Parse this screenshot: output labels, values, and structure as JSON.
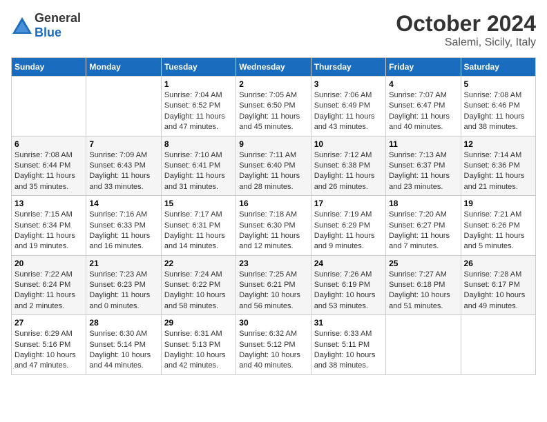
{
  "header": {
    "logo_general": "General",
    "logo_blue": "Blue",
    "month": "October 2024",
    "location": "Salemi, Sicily, Italy"
  },
  "weekdays": [
    "Sunday",
    "Monday",
    "Tuesday",
    "Wednesday",
    "Thursday",
    "Friday",
    "Saturday"
  ],
  "weeks": [
    [
      {
        "day": "",
        "info": ""
      },
      {
        "day": "",
        "info": ""
      },
      {
        "day": "1",
        "info": "Sunrise: 7:04 AM\nSunset: 6:52 PM\nDaylight: 11 hours and 47 minutes."
      },
      {
        "day": "2",
        "info": "Sunrise: 7:05 AM\nSunset: 6:50 PM\nDaylight: 11 hours and 45 minutes."
      },
      {
        "day": "3",
        "info": "Sunrise: 7:06 AM\nSunset: 6:49 PM\nDaylight: 11 hours and 43 minutes."
      },
      {
        "day": "4",
        "info": "Sunrise: 7:07 AM\nSunset: 6:47 PM\nDaylight: 11 hours and 40 minutes."
      },
      {
        "day": "5",
        "info": "Sunrise: 7:08 AM\nSunset: 6:46 PM\nDaylight: 11 hours and 38 minutes."
      }
    ],
    [
      {
        "day": "6",
        "info": "Sunrise: 7:08 AM\nSunset: 6:44 PM\nDaylight: 11 hours and 35 minutes."
      },
      {
        "day": "7",
        "info": "Sunrise: 7:09 AM\nSunset: 6:43 PM\nDaylight: 11 hours and 33 minutes."
      },
      {
        "day": "8",
        "info": "Sunrise: 7:10 AM\nSunset: 6:41 PM\nDaylight: 11 hours and 31 minutes."
      },
      {
        "day": "9",
        "info": "Sunrise: 7:11 AM\nSunset: 6:40 PM\nDaylight: 11 hours and 28 minutes."
      },
      {
        "day": "10",
        "info": "Sunrise: 7:12 AM\nSunset: 6:38 PM\nDaylight: 11 hours and 26 minutes."
      },
      {
        "day": "11",
        "info": "Sunrise: 7:13 AM\nSunset: 6:37 PM\nDaylight: 11 hours and 23 minutes."
      },
      {
        "day": "12",
        "info": "Sunrise: 7:14 AM\nSunset: 6:36 PM\nDaylight: 11 hours and 21 minutes."
      }
    ],
    [
      {
        "day": "13",
        "info": "Sunrise: 7:15 AM\nSunset: 6:34 PM\nDaylight: 11 hours and 19 minutes."
      },
      {
        "day": "14",
        "info": "Sunrise: 7:16 AM\nSunset: 6:33 PM\nDaylight: 11 hours and 16 minutes."
      },
      {
        "day": "15",
        "info": "Sunrise: 7:17 AM\nSunset: 6:31 PM\nDaylight: 11 hours and 14 minutes."
      },
      {
        "day": "16",
        "info": "Sunrise: 7:18 AM\nSunset: 6:30 PM\nDaylight: 11 hours and 12 minutes."
      },
      {
        "day": "17",
        "info": "Sunrise: 7:19 AM\nSunset: 6:29 PM\nDaylight: 11 hours and 9 minutes."
      },
      {
        "day": "18",
        "info": "Sunrise: 7:20 AM\nSunset: 6:27 PM\nDaylight: 11 hours and 7 minutes."
      },
      {
        "day": "19",
        "info": "Sunrise: 7:21 AM\nSunset: 6:26 PM\nDaylight: 11 hours and 5 minutes."
      }
    ],
    [
      {
        "day": "20",
        "info": "Sunrise: 7:22 AM\nSunset: 6:24 PM\nDaylight: 11 hours and 2 minutes."
      },
      {
        "day": "21",
        "info": "Sunrise: 7:23 AM\nSunset: 6:23 PM\nDaylight: 11 hours and 0 minutes."
      },
      {
        "day": "22",
        "info": "Sunrise: 7:24 AM\nSunset: 6:22 PM\nDaylight: 10 hours and 58 minutes."
      },
      {
        "day": "23",
        "info": "Sunrise: 7:25 AM\nSunset: 6:21 PM\nDaylight: 10 hours and 56 minutes."
      },
      {
        "day": "24",
        "info": "Sunrise: 7:26 AM\nSunset: 6:19 PM\nDaylight: 10 hours and 53 minutes."
      },
      {
        "day": "25",
        "info": "Sunrise: 7:27 AM\nSunset: 6:18 PM\nDaylight: 10 hours and 51 minutes."
      },
      {
        "day": "26",
        "info": "Sunrise: 7:28 AM\nSunset: 6:17 PM\nDaylight: 10 hours and 49 minutes."
      }
    ],
    [
      {
        "day": "27",
        "info": "Sunrise: 6:29 AM\nSunset: 5:16 PM\nDaylight: 10 hours and 47 minutes."
      },
      {
        "day": "28",
        "info": "Sunrise: 6:30 AM\nSunset: 5:14 PM\nDaylight: 10 hours and 44 minutes."
      },
      {
        "day": "29",
        "info": "Sunrise: 6:31 AM\nSunset: 5:13 PM\nDaylight: 10 hours and 42 minutes."
      },
      {
        "day": "30",
        "info": "Sunrise: 6:32 AM\nSunset: 5:12 PM\nDaylight: 10 hours and 40 minutes."
      },
      {
        "day": "31",
        "info": "Sunrise: 6:33 AM\nSunset: 5:11 PM\nDaylight: 10 hours and 38 minutes."
      },
      {
        "day": "",
        "info": ""
      },
      {
        "day": "",
        "info": ""
      }
    ]
  ]
}
